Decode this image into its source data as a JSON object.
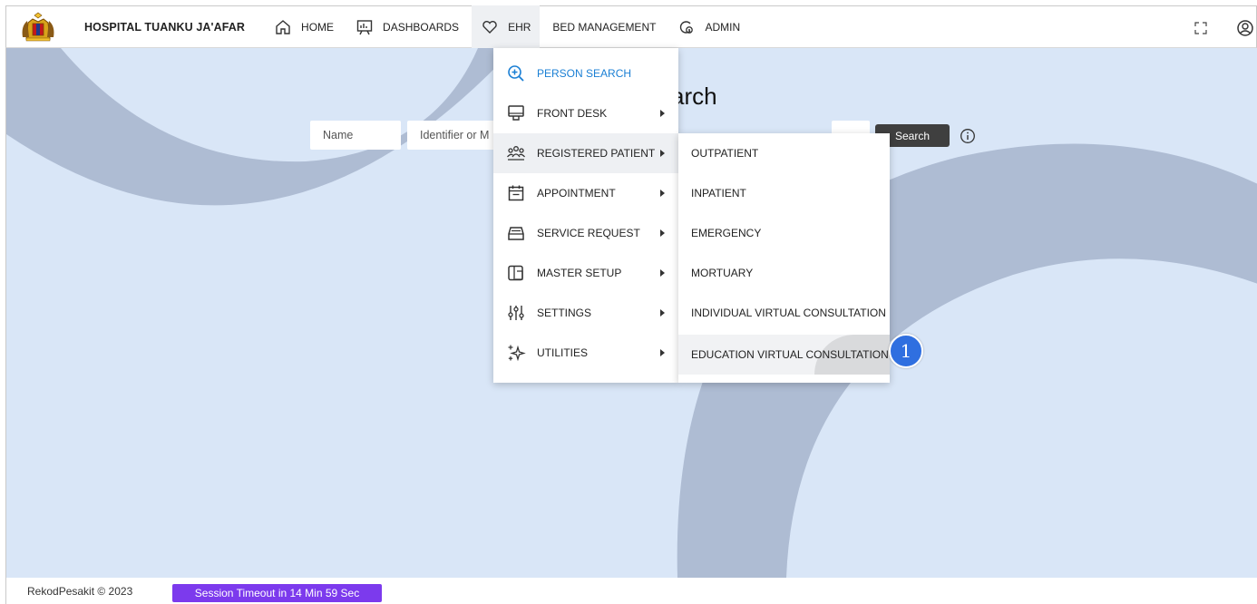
{
  "header": {
    "hospital_name": "HOSPITAL TUANKU JA'AFAR",
    "nav": [
      {
        "label": "HOME",
        "icon": "home-icon"
      },
      {
        "label": "DASHBOARDS",
        "icon": "dashboard-icon"
      },
      {
        "label": "EHR",
        "icon": "heart-icon"
      },
      {
        "label": "BED MANAGEMENT",
        "icon": ""
      },
      {
        "label": "ADMIN",
        "icon": "admin-settings-icon"
      }
    ],
    "right_icons": [
      "fullscreen-icon",
      "user-account-icon"
    ]
  },
  "main": {
    "title_fragment": "arch",
    "search": {
      "name_placeholder": "Name",
      "identifier_placeholder": "Identifier or M",
      "button_label": "Search"
    }
  },
  "ehr_menu": {
    "items": [
      {
        "label": "PERSON SEARCH",
        "icon": "zoom-plus-icon",
        "has_submenu": false
      },
      {
        "label": "FRONT DESK",
        "icon": "monitor-icon",
        "has_submenu": true
      },
      {
        "label": "REGISTERED PATIENT",
        "icon": "people-icon",
        "has_submenu": true
      },
      {
        "label": "APPOINTMENT",
        "icon": "calendar-icon",
        "has_submenu": true
      },
      {
        "label": "SERVICE REQUEST",
        "icon": "tray-icon",
        "has_submenu": true
      },
      {
        "label": "MASTER SETUP",
        "icon": "master-setup-icon",
        "has_submenu": true
      },
      {
        "label": "SETTINGS",
        "icon": "sliders-icon",
        "has_submenu": true
      },
      {
        "label": "UTILITIES",
        "icon": "sparkles-icon",
        "has_submenu": true
      }
    ],
    "submenu": {
      "items": [
        {
          "label": "OUTPATIENT"
        },
        {
          "label": "INPATIENT"
        },
        {
          "label": "EMERGENCY"
        },
        {
          "label": "MORTUARY"
        },
        {
          "label": "INDIVIDUAL VIRTUAL CONSULTATION"
        },
        {
          "label": "EDUCATION VIRTUAL CONSULTATION"
        }
      ]
    }
  },
  "annotation": {
    "step": "1"
  },
  "footer": {
    "copyright": "RekodPesakit © 2023",
    "session_timeout": "Session Timeout in 14 Min 59 Sec"
  },
  "colors": {
    "active_menu_text": "#1a7fd4",
    "session_badge": "#7c3aed",
    "step_badge": "#2f6fe0",
    "background": "#d9e6f7",
    "decoration": "#aebcd3"
  }
}
